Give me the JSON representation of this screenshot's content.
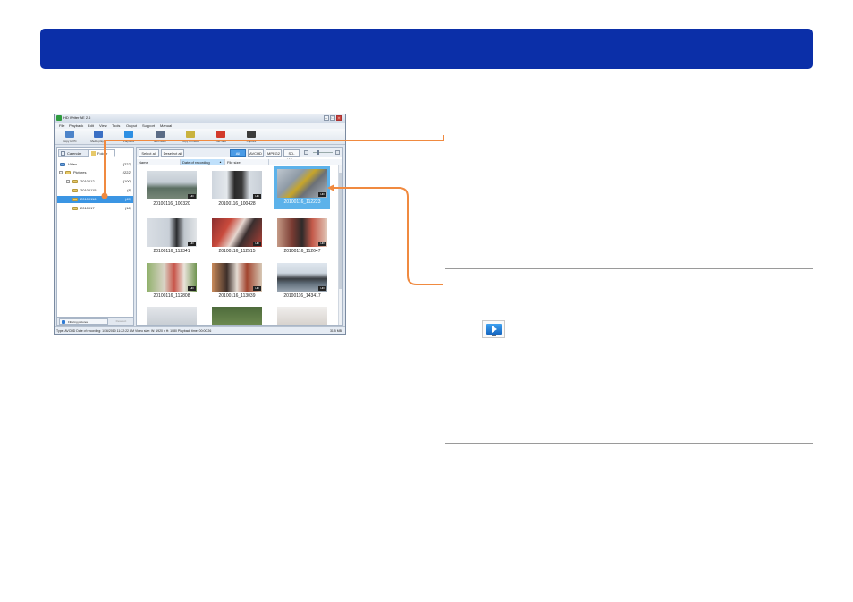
{
  "window": {
    "title": "HD Writer AE 2.6",
    "menus": [
      "File",
      "Playback",
      "Edit",
      "View",
      "Tools",
      "Output",
      "Support",
      "Manual"
    ]
  },
  "toolbar": {
    "items": [
      {
        "label": "Copy to PC",
        "icon": "copy-to-pc-icon"
      },
      {
        "label": "Media player",
        "icon": "media-player-icon"
      },
      {
        "label": "Playback",
        "icon": "playback-icon"
      },
      {
        "label": "Edit video",
        "icon": "edit-video-icon"
      },
      {
        "label": "Copy to media",
        "icon": "copy-to-media-icon"
      },
      {
        "label": "YouTube",
        "icon": "youtube-icon"
      },
      {
        "label": "Capture",
        "icon": "camera-icon"
      }
    ]
  },
  "left_pane": {
    "tabs": [
      "Calendar",
      "Folder"
    ],
    "tree": [
      {
        "name": "Video",
        "count": "(222)"
      },
      {
        "name": "Pictures",
        "count": "(222)"
      },
      {
        "name": "2010012",
        "count": "(100)"
      },
      {
        "name": "20100115",
        "count": "(8)"
      },
      {
        "name": "20100116",
        "count": "(45)"
      },
      {
        "name": "2010017",
        "count": "(16)"
      }
    ],
    "filter_label": "Filtering pictures",
    "deselect_label": "Deselect"
  },
  "right_pane": {
    "select_all": "Select all",
    "deselect_all": "Deselect all",
    "filters": [
      "All",
      "AVCHD",
      "MPEG2",
      "SD-Video"
    ],
    "sort_columns": [
      "Name",
      "Date of recording",
      "File size"
    ],
    "thumbnails": [
      {
        "name": "20100116_100320",
        "badge": "HD"
      },
      {
        "name": "20100116_100428",
        "badge": "HD"
      },
      {
        "name": "20100116_112223",
        "badge": "HD"
      },
      {
        "name": "20100116_112341",
        "badge": "HD"
      },
      {
        "name": "20100116_112515",
        "badge": "HD"
      },
      {
        "name": "20100116_112647",
        "badge": "HD"
      },
      {
        "name": "20100116_112808",
        "badge": "HD"
      },
      {
        "name": "20100116_113039",
        "badge": "HD"
      },
      {
        "name": "20100116_143417",
        "badge": "HD"
      }
    ]
  },
  "status": {
    "text": "Type: AVCHD  Date of recording: 1/16/2010 11:22:22 AM  Video size: W: 1920 x H: 1080  Playback time: 00:00:26",
    "size": "31.5 MB"
  },
  "colors": {
    "banner": "#0b2fa8",
    "callout_line": "#f08a40",
    "selection": "#3b95e3"
  }
}
